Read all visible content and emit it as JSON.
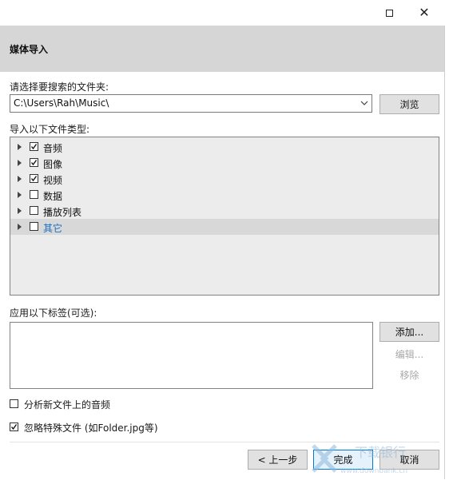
{
  "dialog": {
    "header_title": "媒体导入"
  },
  "folder": {
    "label": "请选择要搜索的文件夹:",
    "path": "C:\\Users\\Rah\\Music\\",
    "browse_label": "浏览"
  },
  "file_types": {
    "label": "导入以下文件类型:",
    "items": [
      {
        "label": "音频",
        "checked": true
      },
      {
        "label": "图像",
        "checked": true
      },
      {
        "label": "视频",
        "checked": true
      },
      {
        "label": "数据",
        "checked": false
      },
      {
        "label": "播放列表",
        "checked": false
      },
      {
        "label": "其它",
        "checked": false,
        "selected": true
      }
    ]
  },
  "tags": {
    "label": "应用以下标签(可选):",
    "add_label": "添加...",
    "edit_label": "编辑...",
    "remove_label": "移除"
  },
  "options": {
    "analyze_label": "分析新文件上的音频",
    "analyze_checked": false,
    "ignore_label": "忽略特殊文件 (如Folder.jpg等)",
    "ignore_checked": true
  },
  "footer": {
    "back_label": "< 上一步",
    "finish_label": "完成",
    "cancel_label": "取消"
  },
  "watermark": {
    "text": "下载银行",
    "url": "www.downbank.cn"
  }
}
